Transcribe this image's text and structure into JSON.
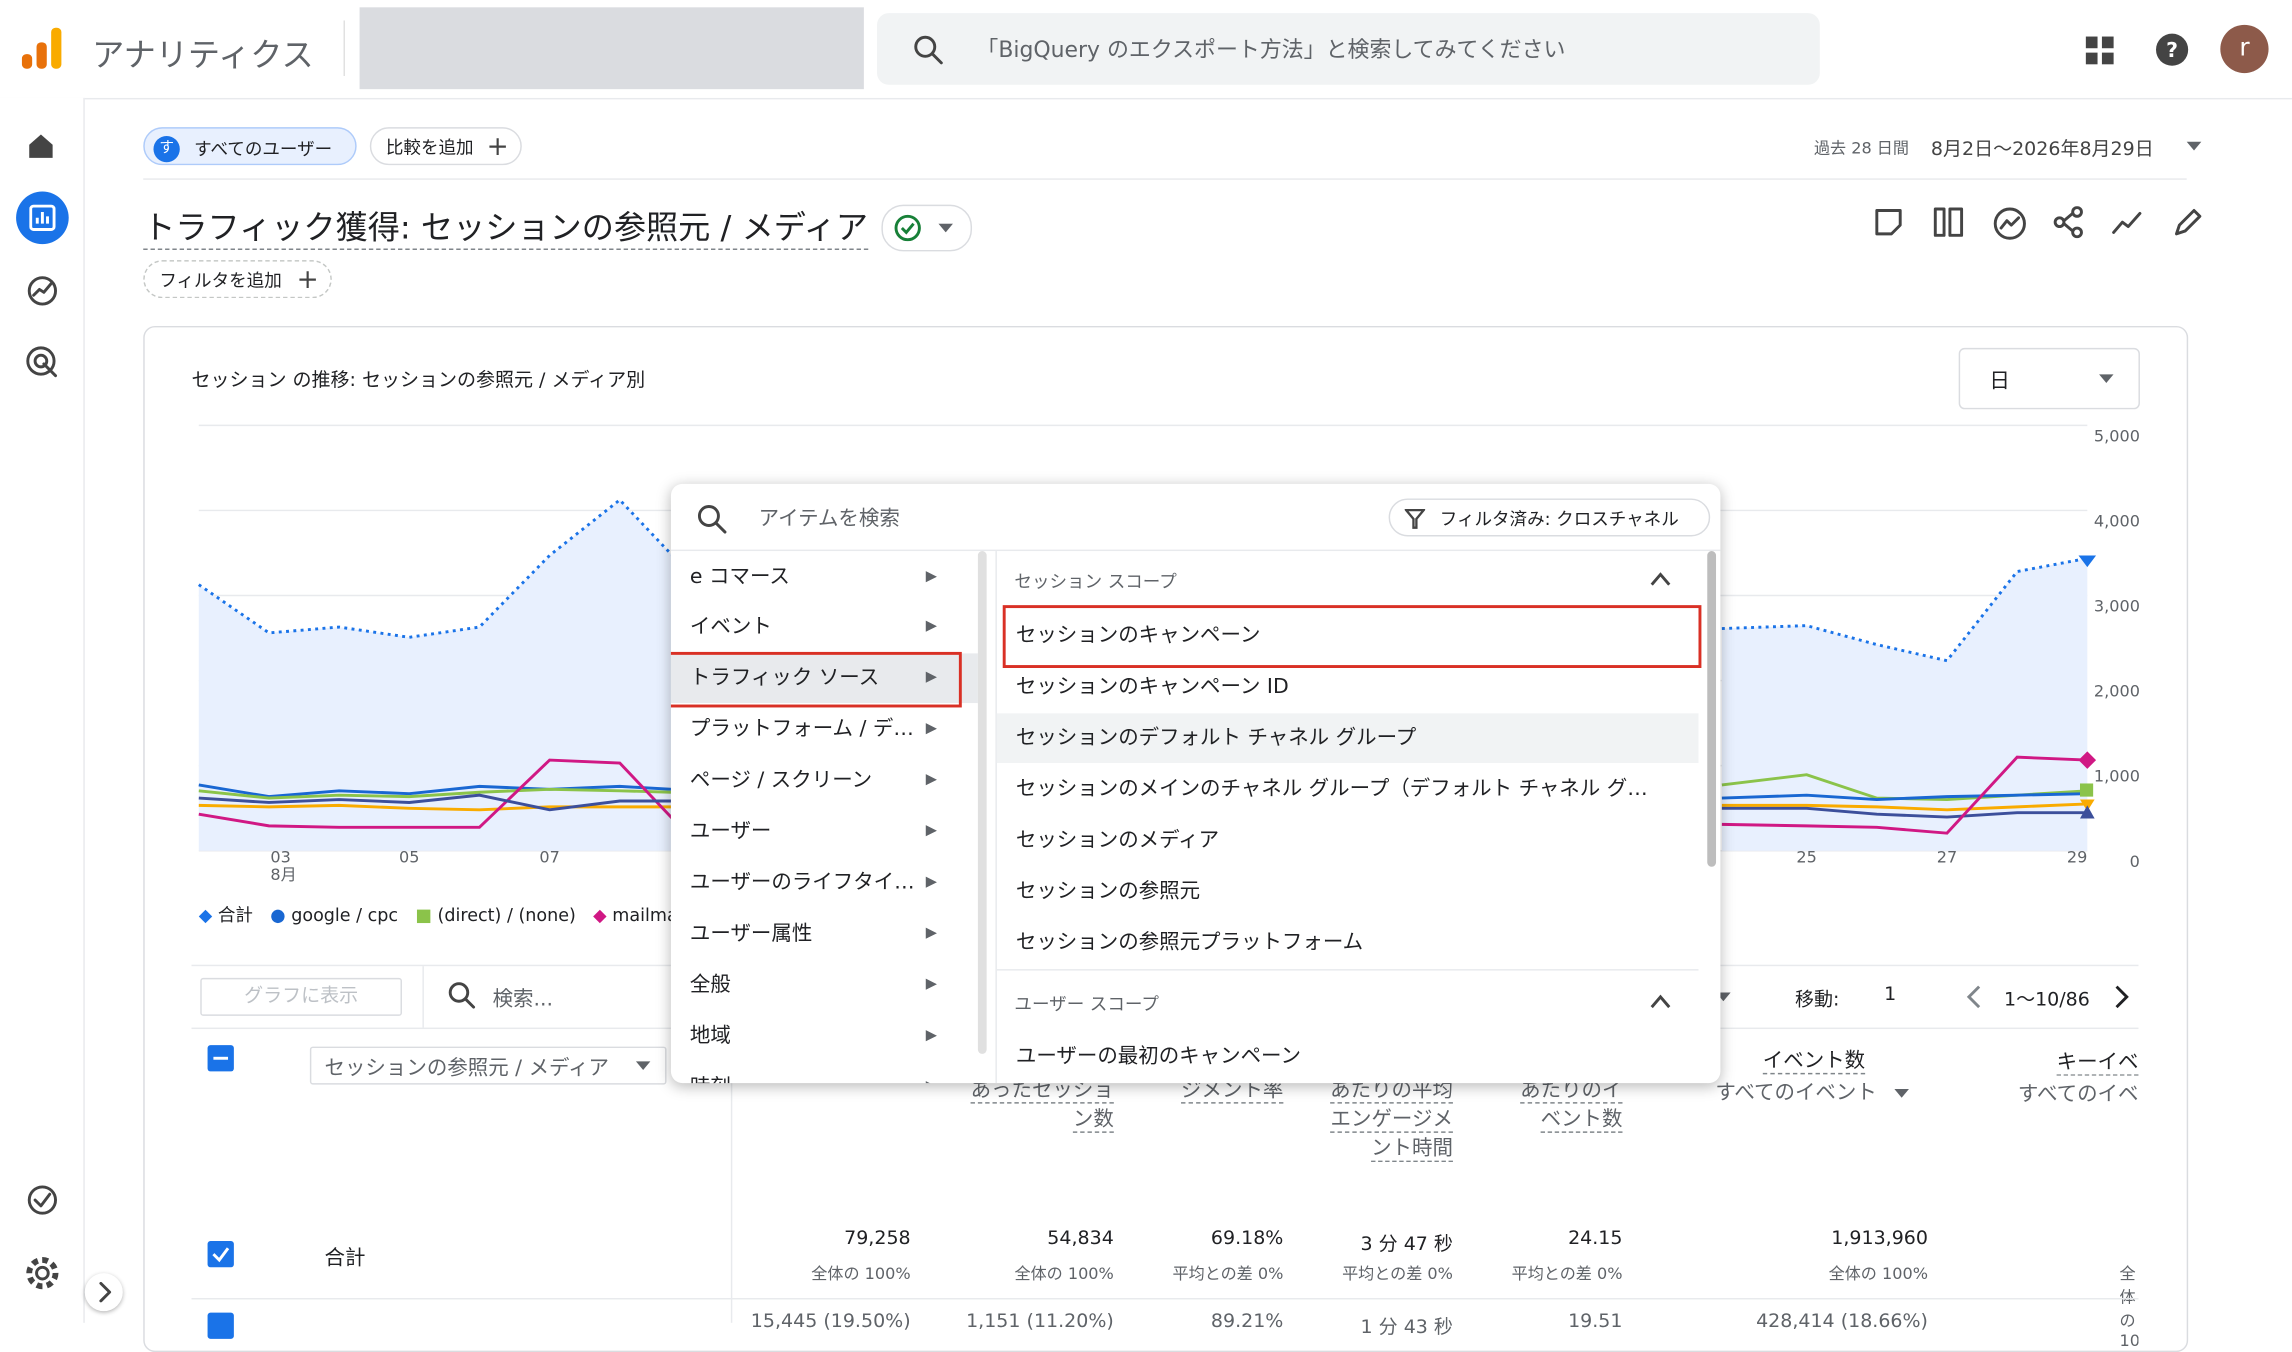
{
  "app": {
    "title": "アナリティクス",
    "search_placeholder": "「BigQuery のエクスポート方法」と検索してみてください",
    "avatar_letter": "r"
  },
  "toolbar": {
    "segment_chip": "すべてのユーザー",
    "segment_badge": "す",
    "compare_chip": "比較を追加",
    "date_prefix": "過去 28 日間",
    "date_range": "8月2日〜2026年8月29日"
  },
  "report": {
    "title": "トラフィック獲得: セッションの参照元 / メディア",
    "add_filter": "フィルタを追加"
  },
  "chart": {
    "title": "セッション の推移: セッションの参照元 / メディア別",
    "granularity": "日"
  },
  "chart_data": {
    "type": "line",
    "x": [
      "03",
      "05",
      "07",
      "25",
      "27",
      "29"
    ],
    "x_sub_label": "8月",
    "ylim": [
      0,
      5000
    ],
    "y_ticks": [
      "5,000",
      "4,000",
      "3,000",
      "2,000",
      "1,000",
      "0"
    ],
    "legend_position": "bottom-left",
    "grid": true,
    "series": [
      {
        "name": "合計",
        "color": "#1a73e8",
        "style": "area-dotted"
      },
      {
        "name": "google / cpc",
        "color": "#1967d2"
      },
      {
        "name": "(direct) / (none)",
        "color": "#8bc34a"
      },
      {
        "name": "mailmag",
        "color": "#d01884"
      }
    ]
  },
  "dropdown": {
    "search_placeholder": "アイテムを検索",
    "filter_chip": "フィルタ済み: クロスチャネル",
    "categories": [
      "e コマース",
      "イベント",
      "トラフィック ソース",
      "プラットフォーム / デ…",
      "ページ / スクリーン",
      "ユーザー",
      "ユーザーのライフタイ…",
      "ユーザー属性",
      "全般",
      "地域",
      "時刻"
    ],
    "session_scope_label": "セッション スコープ",
    "session_options": [
      "セッションのキャンペーン",
      "セッションのキャンペーン ID",
      "セッションのデフォルト チャネル グループ",
      "セッションのメインのチャネル グループ（デフォルト チャネル グ…",
      "セッションのメディア",
      "セッションの参照元",
      "セッションの参照元プラットフォーム"
    ],
    "user_scope_label": "ユーザー スコープ",
    "user_options": [
      "ユーザーの最初のキャンペーン"
    ]
  },
  "table": {
    "show_in_chart": "グラフに表示",
    "search_placeholder": "検索...",
    "goto_label": "移動:",
    "goto_value": "1",
    "pagination": "1〜10/86",
    "dimension_dropdown": "セッションの参照元 / メディア",
    "headers": [
      {
        "label": "あったセッション数"
      },
      {
        "label": "ジメント率"
      },
      {
        "label": "あたりの平均エンゲージメント時間"
      },
      {
        "label": "あたりのイベント数"
      },
      {
        "label": "イベント数",
        "sub": "すべてのイベント"
      },
      {
        "label": "キーイベ",
        "sub": "すべてのイベ"
      }
    ],
    "total_row": {
      "label": "合計",
      "values": [
        "79,258",
        "54,834",
        "69.18%",
        "3 分 47 秒",
        "24.15",
        "1,913,960"
      ],
      "subs": [
        "全体の 100%",
        "全体の 100%",
        "平均との差 0%",
        "平均との差 0%",
        "平均との差 0%",
        "全体の 100%"
      ]
    },
    "next_row_partial": [
      "15,445 (19.50%)",
      "1,151 (11.20%)",
      "89.21%",
      "1 分 43 秒",
      "19.51",
      "428,414 (18.66%)"
    ]
  }
}
